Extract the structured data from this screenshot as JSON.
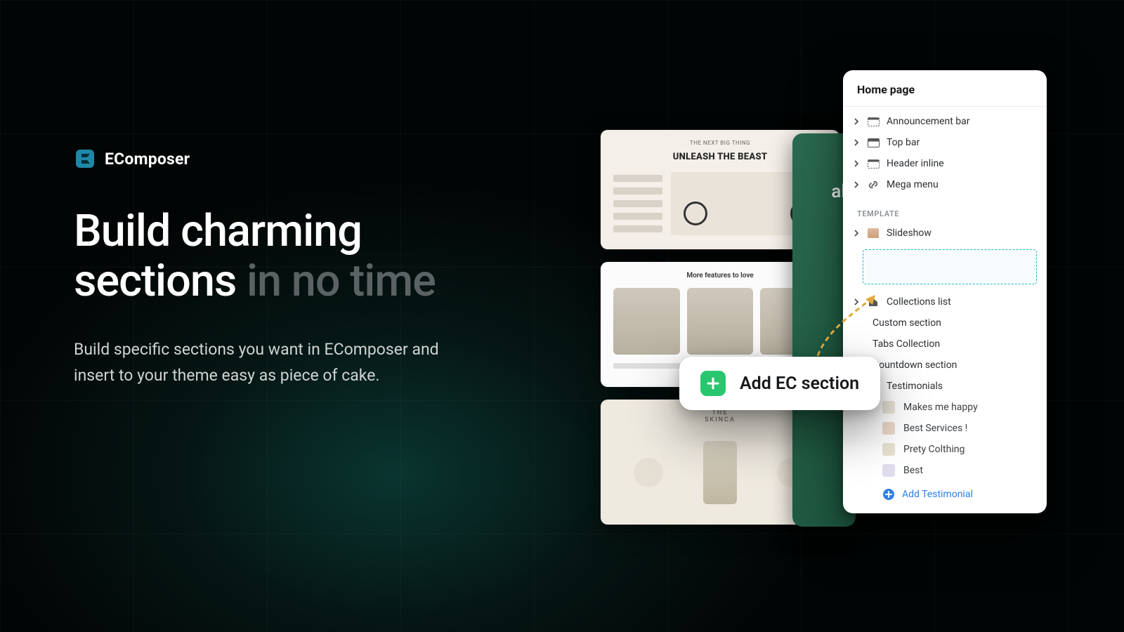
{
  "brand": {
    "name": "EComposer"
  },
  "headline": {
    "line1_strong": "Build charming",
    "line2_strong": "sections",
    "line2_dim": " in no time"
  },
  "description": "Build specific sections you want in EComposer and insert to your theme easy as piece of cake.",
  "thumbs": {
    "t1_kicker": "THE NEXT BIG THING",
    "t1_title": "UNLEASH THE BEAST",
    "t2_title": "More features to love",
    "t3_kicker": "THE",
    "t3_title": "SKINCA"
  },
  "greenstrip_text": "ab",
  "panel": {
    "title": "Home page",
    "header_items": [
      {
        "label": "Announcement bar",
        "icon": "layout-top"
      },
      {
        "label": "Top bar",
        "icon": "layout-top"
      },
      {
        "label": "Header inline",
        "icon": "layout-top"
      },
      {
        "label": "Mega menu",
        "icon": "link"
      }
    ],
    "template_label": "TEMPLATE",
    "template_items": [
      {
        "label": "Slideshow",
        "icon": "image",
        "expandable": true
      }
    ],
    "after_drop": [
      {
        "label": "Collections list",
        "icon": "house",
        "expandable": true
      },
      {
        "label": "Custom section",
        "plain": true
      },
      {
        "label": "Tabs Collection",
        "plain": true
      },
      {
        "label": "Countdown section",
        "plain": true
      }
    ],
    "testimonials": {
      "label": "Testimonials",
      "icon": "image",
      "expanded": true,
      "children": [
        "Makes me happy",
        "Best Services !",
        "Prety Colthing",
        "Best"
      ],
      "add_label": "Add Testimonial"
    }
  },
  "add_chip": {
    "label": "Add EC section"
  }
}
